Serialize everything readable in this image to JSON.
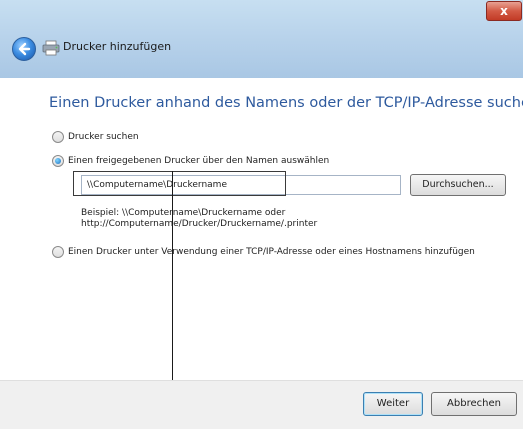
{
  "window": {
    "title": "Drucker hinzufügen",
    "close_label": "x"
  },
  "heading": "Einen Drucker anhand des Namens oder der TCP/IP-Adresse suchen",
  "options": [
    {
      "label": "Drucker suchen",
      "checked": false
    },
    {
      "label": "Einen freigegebenen Drucker über den Namen auswählen",
      "checked": true
    },
    {
      "label": "Einen Drucker unter Verwendung einer TCP/IP-Adresse oder eines Hostnamens hinzufügen",
      "checked": false
    }
  ],
  "name_input": {
    "value": "\\\\Computername\\Druckername"
  },
  "browse_label": "Durchsuchen...",
  "example": {
    "line1": "Beispiel: \\\\Computername\\Druckername oder",
    "line2": "http://Computername/Drucker/Druckername/.printer"
  },
  "footer": {
    "next_label": "Weiter",
    "cancel_label": "Abbrechen"
  },
  "colors": {
    "heading": "#2e5a9e",
    "titlebar": "#b6d1ea",
    "close_button": "#c23b26"
  }
}
